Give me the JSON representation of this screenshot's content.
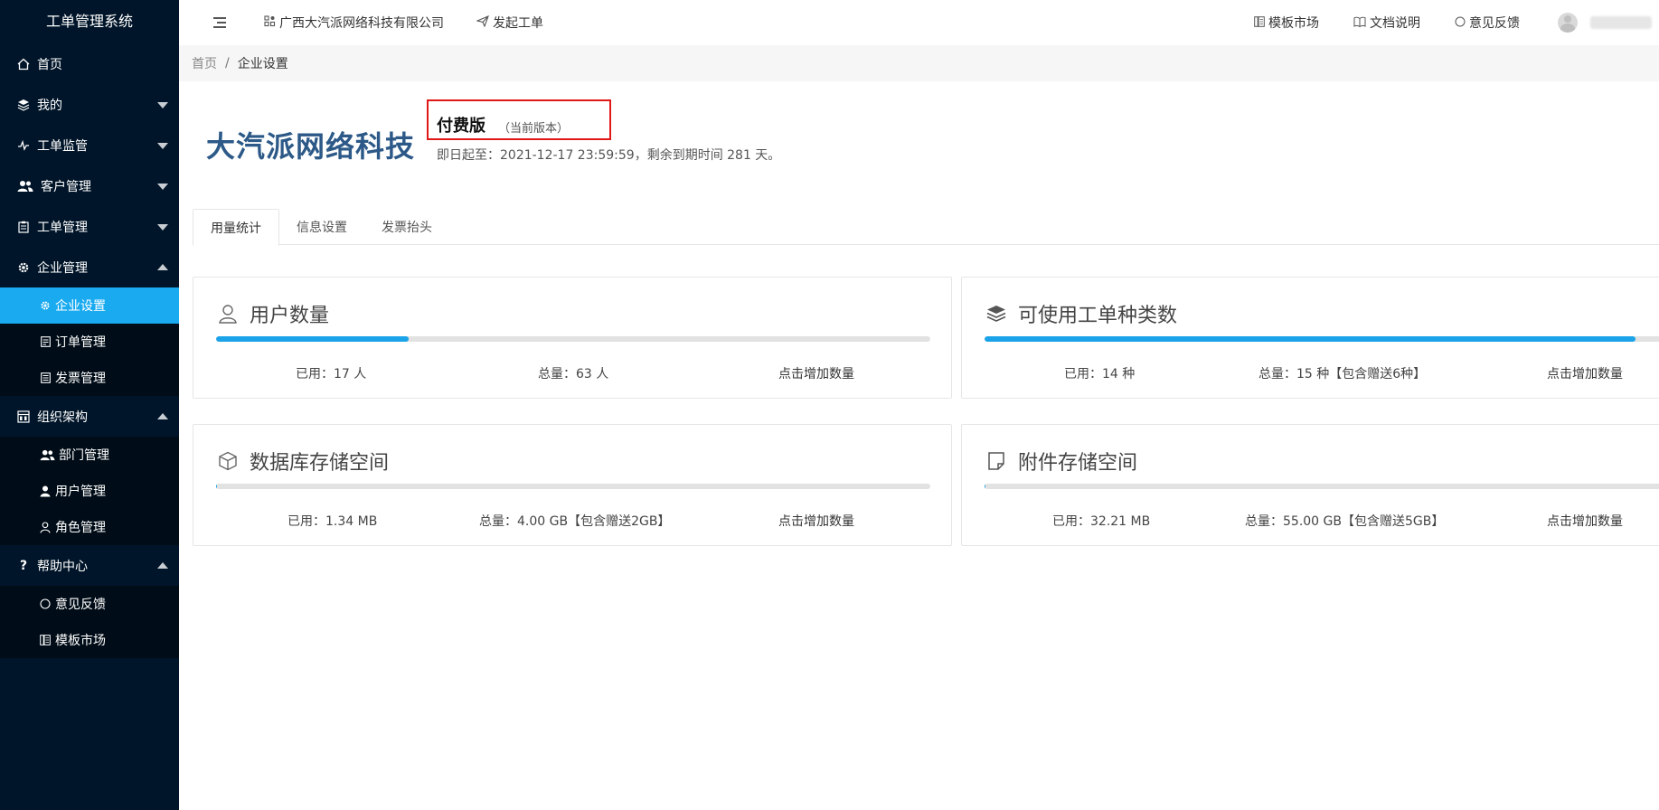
{
  "sidebar": {
    "brand": "工单管理系统",
    "menu": {
      "home": "首页",
      "mine": "我的",
      "monitor": "工单监管",
      "customer": "客户管理",
      "workorder": "工单管理",
      "enterprise": "企业管理",
      "enterprise_sub": [
        "企业设置",
        "订单管理",
        "发票管理"
      ],
      "org": "组织架构",
      "org_sub": [
        "部门管理",
        "用户管理",
        "角色管理"
      ],
      "help": "帮助中心",
      "help_sub": [
        "意见反馈",
        "模板市场"
      ]
    }
  },
  "header": {
    "company": "广西大汽派网络科技有限公司",
    "start_order": "发起工单",
    "template_market": "模板市场",
    "docs": "文档说明",
    "feedback": "意见反馈"
  },
  "breadcrumb": {
    "home": "首页",
    "separator": "/",
    "current": "企业设置"
  },
  "company_info": {
    "name": "大汽派网络科技",
    "version": "付费版",
    "version_note": "（当前版本）",
    "expire_text": "即日起至：2021-12-17 23:59:59，剩余到期时间 281 天。"
  },
  "tabs": [
    "用量统计",
    "信息设置",
    "发票抬头"
  ],
  "cards": [
    {
      "title": "用户数量",
      "used": "已用：17 人",
      "total": "总量：63 人",
      "action": "点击增加数量",
      "progress": 0.27
    },
    {
      "title": "可使用工单种类数",
      "used": "已用：14 种",
      "total": "总量：15 种【包含赠送6种】",
      "action": "点击增加数量",
      "progress": 0.933
    },
    {
      "title": "数据库存储空间",
      "used": "已用：1.34 MB",
      "total": "总量：4.00 GB【包含赠送2GB】",
      "action": "点击增加数量",
      "progress": 0.0003
    },
    {
      "title": "附件存储空间",
      "used": "已用：32.21 MB",
      "total": "总量：55.00 GB【包含赠送5GB】",
      "action": "点击增加数量",
      "progress": 0.0006
    }
  ],
  "colors": {
    "sidebar_bg": "#001529",
    "active_item": "#19aaf0",
    "progress_fill": "#1aa3e8",
    "company_name": "#2c5987",
    "highlight_border": "#e01818"
  }
}
